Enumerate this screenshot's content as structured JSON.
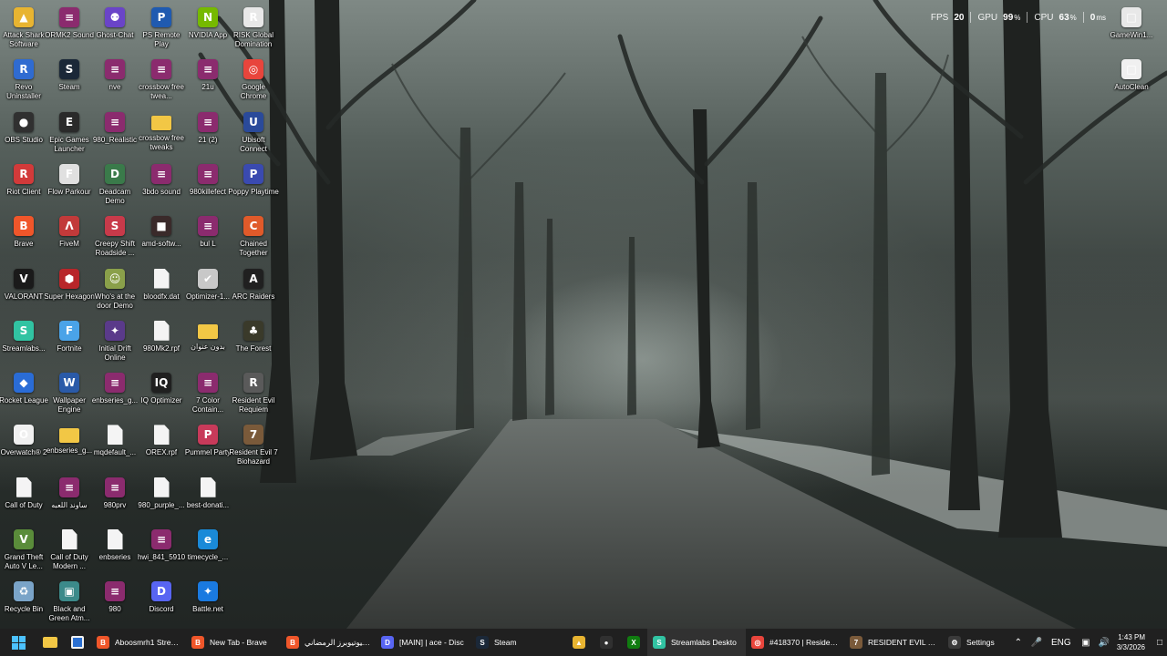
{
  "performance": {
    "fps_label": "FPS",
    "fps_value": "20",
    "gpu_label": "GPU",
    "gpu_value": "99",
    "gpu_unit": "%",
    "cpu_label": "CPU",
    "cpu_value": "63",
    "cpu_unit": "%",
    "extra_value": "0",
    "extra_unit": "ms"
  },
  "desktop_icons": [
    {
      "label": "Attack Shark Software",
      "icon": "shark-icon",
      "color": "#e8b431",
      "glyph": "▲",
      "col": 0,
      "row": 0
    },
    {
      "label": "Revo Uninstaller",
      "icon": "revo-icon",
      "color": "#2f6bd1",
      "glyph": "R",
      "col": 0,
      "row": 1
    },
    {
      "label": "OBS Studio",
      "icon": "obs-icon",
      "color": "#303030",
      "glyph": "●",
      "col": 0,
      "row": 2
    },
    {
      "label": "Riot Client",
      "icon": "riot-icon",
      "color": "#d23a3a",
      "glyph": "R",
      "col": 0,
      "row": 3
    },
    {
      "label": "Brave",
      "icon": "brave-icon",
      "color": "#f0562a",
      "glyph": "B",
      "col": 0,
      "row": 4
    },
    {
      "label": "VALORANT",
      "icon": "valorant-icon",
      "color": "#1a1a1a",
      "glyph": "V",
      "col": 0,
      "row": 5
    },
    {
      "label": "Streamlabs...",
      "icon": "streamlabs-icon",
      "color": "#31c3a2",
      "glyph": "S",
      "col": 0,
      "row": 6
    },
    {
      "label": "Rocket League",
      "icon": "rocket-league-icon",
      "color": "#2a6cd6",
      "glyph": "◆",
      "col": 0,
      "row": 7
    },
    {
      "label": "Overwatch® 2",
      "icon": "overwatch-icon",
      "color": "#f0f0f0",
      "glyph": "O",
      "col": 0,
      "row": 8
    },
    {
      "label": "Call of Duty",
      "icon": "doc-icon",
      "color": "",
      "glyph": "",
      "col": 0,
      "row": 9,
      "kind": "doc"
    },
    {
      "label": "Grand Theft Auto V Le...",
      "icon": "gta-icon",
      "color": "#5a8c3a",
      "glyph": "V",
      "col": 0,
      "row": 10
    },
    {
      "label": "Recycle Bin",
      "icon": "recycle-bin-icon",
      "color": "#7aa4c8",
      "glyph": "♻",
      "col": 0,
      "row": 11
    },
    {
      "label": "ORMK2 Sound",
      "icon": "winrar-icon",
      "color": "#8b2b6e",
      "glyph": "≡",
      "col": 1,
      "row": 0
    },
    {
      "label": "Steam",
      "icon": "steam-icon",
      "color": "#1b2838",
      "glyph": "S",
      "col": 1,
      "row": 1
    },
    {
      "label": "Epic Games Launcher",
      "icon": "epic-icon",
      "color": "#2a2a2a",
      "glyph": "E",
      "col": 1,
      "row": 2
    },
    {
      "label": "Flow Parkour",
      "icon": "flow-parkour-icon",
      "color": "#e0e0e0",
      "glyph": "F",
      "col": 1,
      "row": 3
    },
    {
      "label": "FiveM",
      "icon": "fivem-icon",
      "color": "#c23a3a",
      "glyph": "Λ",
      "col": 1,
      "row": 4
    },
    {
      "label": "Super Hexagon",
      "icon": "super-hexagon-icon",
      "color": "#b8262a",
      "glyph": "⬢",
      "col": 1,
      "row": 5
    },
    {
      "label": "Fortnite",
      "icon": "fortnite-icon",
      "color": "#4aa3e8",
      "glyph": "F",
      "col": 1,
      "row": 6
    },
    {
      "label": "Wallpaper Engine",
      "icon": "wallpaper-engine-icon",
      "color": "#2a5aa8",
      "glyph": "W",
      "col": 1,
      "row": 7
    },
    {
      "label": "enbseries_g...",
      "icon": "folder-icon",
      "color": "",
      "glyph": "",
      "col": 1,
      "row": 8,
      "kind": "folder"
    },
    {
      "label": "ساوند اللعبه",
      "icon": "winrar-icon",
      "color": "#8b2b6e",
      "glyph": "≡",
      "col": 1,
      "row": 9
    },
    {
      "label": "Call of Duty Modern ...",
      "icon": "doc-icon",
      "color": "",
      "glyph": "",
      "col": 1,
      "row": 10,
      "kind": "doc"
    },
    {
      "label": "Black and Green Atm...",
      "icon": "black-green-icon",
      "color": "#3c8a8a",
      "glyph": "▣",
      "col": 1,
      "row": 11
    },
    {
      "label": "Ghost-Chat",
      "icon": "ghost-chat-icon",
      "color": "#6a44c8",
      "glyph": "⚉",
      "col": 2,
      "row": 0
    },
    {
      "label": "nve",
      "icon": "winrar-icon",
      "color": "#8b2b6e",
      "glyph": "≡",
      "col": 2,
      "row": 1
    },
    {
      "label": "980_Realistic",
      "icon": "winrar-icon",
      "color": "#8b2b6e",
      "glyph": "≡",
      "col": 2,
      "row": 2
    },
    {
      "label": "Deadcam Demo",
      "icon": "deadcam-icon",
      "color": "#3a7a4a",
      "glyph": "D",
      "col": 2,
      "row": 3
    },
    {
      "label": "Creepy Shift Roadside ...",
      "icon": "creepy-shift-icon",
      "color": "#c83a4a",
      "glyph": "S",
      "col": 2,
      "row": 4
    },
    {
      "label": "Who's at the door Demo",
      "icon": "whos-at-door-icon",
      "color": "#8aa04a",
      "glyph": "☺",
      "col": 2,
      "row": 5
    },
    {
      "label": "Initial Drift Online",
      "icon": "initial-drift-icon",
      "color": "#5a3a8a",
      "glyph": "✦",
      "col": 2,
      "row": 6
    },
    {
      "label": "enbseries_g...",
      "icon": "winrar-icon",
      "color": "#8b2b6e",
      "glyph": "≡",
      "col": 2,
      "row": 7
    },
    {
      "label": "mqdefault_...",
      "icon": "doc-icon",
      "color": "",
      "glyph": "",
      "col": 2,
      "row": 8,
      "kind": "doc"
    },
    {
      "label": "980prv",
      "icon": "winrar-icon",
      "color": "#8b2b6e",
      "glyph": "≡",
      "col": 2,
      "row": 9
    },
    {
      "label": "enbseries",
      "icon": "doc-icon",
      "color": "",
      "glyph": "",
      "col": 2,
      "row": 10,
      "kind": "doc"
    },
    {
      "label": "980",
      "icon": "winrar-icon",
      "color": "#8b2b6e",
      "glyph": "≡",
      "col": 2,
      "row": 11
    },
    {
      "label": "PS Remote Play",
      "icon": "ps-remote-icon",
      "color": "#1f5ab0",
      "glyph": "P",
      "col": 3,
      "row": 0
    },
    {
      "label": "crossbow free twea...",
      "icon": "winrar-icon",
      "color": "#8b2b6e",
      "glyph": "≡",
      "col": 3,
      "row": 1
    },
    {
      "label": "crossbow free tweaks",
      "icon": "folder-icon",
      "color": "",
      "glyph": "",
      "col": 3,
      "row": 2,
      "kind": "folder"
    },
    {
      "label": "3bdo sound",
      "icon": "winrar-icon",
      "color": "#8b2b6e",
      "glyph": "≡",
      "col": 3,
      "row": 3
    },
    {
      "label": "amd-softw...",
      "icon": "amd-icon",
      "color": "#3a2a2a",
      "glyph": "■",
      "col": 3,
      "row": 4
    },
    {
      "label": "bloodfx.dat",
      "icon": "doc-icon",
      "color": "",
      "glyph": "",
      "col": 3,
      "row": 5,
      "kind": "doc"
    },
    {
      "label": "980Mk2.rpf",
      "icon": "doc-icon",
      "color": "",
      "glyph": "",
      "col": 3,
      "row": 6,
      "kind": "doc"
    },
    {
      "label": "IQ Optimizer",
      "icon": "iq-optimizer-icon",
      "color": "#202020",
      "glyph": "IQ",
      "col": 3,
      "row": 7
    },
    {
      "label": "OREX.rpf",
      "icon": "doc-icon",
      "color": "",
      "glyph": "",
      "col": 3,
      "row": 8,
      "kind": "doc"
    },
    {
      "label": "980_purple_...",
      "icon": "doc-icon",
      "color": "",
      "glyph": "",
      "col": 3,
      "row": 9,
      "kind": "doc"
    },
    {
      "label": "hwi_841_5910",
      "icon": "winrar-icon",
      "color": "#8b2b6e",
      "glyph": "≡",
      "col": 3,
      "row": 10
    },
    {
      "label": "Discord",
      "icon": "discord-icon",
      "color": "#5865f2",
      "glyph": "D",
      "col": 3,
      "row": 11
    },
    {
      "label": "NVIDIA App",
      "icon": "nvidia-icon",
      "color": "#76b900",
      "glyph": "N",
      "col": 4,
      "row": 0
    },
    {
      "label": "21u",
      "icon": "winrar-icon",
      "color": "#8b2b6e",
      "glyph": "≡",
      "col": 4,
      "row": 1
    },
    {
      "label": "21 (2)",
      "icon": "winrar-icon",
      "color": "#8b2b6e",
      "glyph": "≡",
      "col": 4,
      "row": 2
    },
    {
      "label": "980killefect",
      "icon": "winrar-icon",
      "color": "#8b2b6e",
      "glyph": "≡",
      "col": 4,
      "row": 3
    },
    {
      "label": "bul L",
      "icon": "winrar-icon",
      "color": "#8b2b6e",
      "glyph": "≡",
      "col": 4,
      "row": 4
    },
    {
      "label": "Optimizer-1...",
      "icon": "optimizer-icon",
      "color": "#c8c8c8",
      "glyph": "✔",
      "col": 4,
      "row": 5
    },
    {
      "label": "بدون عنوان",
      "icon": "folder-icon",
      "color": "",
      "glyph": "",
      "col": 4,
      "row": 6,
      "kind": "folder"
    },
    {
      "label": "7 Color Contain...",
      "icon": "winrar-icon",
      "color": "#8b2b6e",
      "glyph": "≡",
      "col": 4,
      "row": 7
    },
    {
      "label": "Pummel Party",
      "icon": "pummel-party-icon",
      "color": "#c83a5a",
      "glyph": "P",
      "col": 4,
      "row": 8
    },
    {
      "label": "best-donati...",
      "icon": "doc-icon",
      "color": "",
      "glyph": "",
      "col": 4,
      "row": 9,
      "kind": "doc"
    },
    {
      "label": "timecycle_...",
      "icon": "edge-icon",
      "color": "#1a8ad8",
      "glyph": "e",
      "col": 4,
      "row": 10
    },
    {
      "label": "Battle.net",
      "icon": "battlenet-icon",
      "color": "#1a7ae0",
      "glyph": "✦",
      "col": 4,
      "row": 11
    },
    {
      "label": "RISK Global Domination",
      "icon": "risk-icon",
      "color": "#e8e8e8",
      "glyph": "R",
      "col": 5,
      "row": 0
    },
    {
      "label": "Google Chrome",
      "icon": "chrome-icon",
      "color": "#e8453c",
      "glyph": "◎",
      "col": 5,
      "row": 1
    },
    {
      "label": "Ubisoft Connect",
      "icon": "ubisoft-icon",
      "color": "#2a4a9a",
      "glyph": "U",
      "col": 5,
      "row": 2
    },
    {
      "label": "Poppy Playtime",
      "icon": "poppy-icon",
      "color": "#3a4ab0",
      "glyph": "P",
      "col": 5,
      "row": 3
    },
    {
      "label": "Chained Together",
      "icon": "chained-icon",
      "color": "#e05a2a",
      "glyph": "C",
      "col": 5,
      "row": 4
    },
    {
      "label": "ARC Raiders",
      "icon": "arc-raiders-icon",
      "color": "#202020",
      "glyph": "A",
      "col": 5,
      "row": 5
    },
    {
      "label": "The Forest",
      "icon": "the-forest-icon",
      "color": "#3a3a2a",
      "glyph": "♣",
      "col": 5,
      "row": 6
    },
    {
      "label": "Resident Evil Requiem",
      "icon": "re-requiem-icon",
      "color": "#5a5a5a",
      "glyph": "R",
      "col": 5,
      "row": 7
    },
    {
      "label": "Resident Evil 7 Biohazard",
      "icon": "re7-icon",
      "color": "#7a5a3a",
      "glyph": "7",
      "col": 5,
      "row": 8
    }
  ],
  "right_icons": [
    {
      "label": "GameWin1...",
      "icon": "gamewin-icon",
      "col": "r",
      "row": 0
    },
    {
      "label": "AutoClean",
      "icon": "autoclean-icon",
      "col": "r",
      "row": 1
    }
  ],
  "taskbar": {
    "apps": [
      {
        "label": "Aboosmrh1 Stream - V",
        "icon": "brave-icon",
        "color": "#f0562a",
        "glyph": "B"
      },
      {
        "label": "New Tab - Brave",
        "icon": "brave-icon",
        "color": "#f0562a",
        "glyph": "B"
      },
      {
        "label": "تحدي اليوتيوبرز الرمضاني",
        "icon": "brave-icon",
        "color": "#f0562a",
        "glyph": "B"
      },
      {
        "label": "[MAIN] | ace - Disc",
        "icon": "discord-icon",
        "color": "#5865f2",
        "glyph": "D"
      },
      {
        "label": "Steam",
        "icon": "steam-icon",
        "color": "#1b2838",
        "glyph": "S"
      }
    ],
    "pinned": [
      {
        "icon": "shark-taskbar-icon",
        "color": "#e8b431",
        "glyph": "▲"
      },
      {
        "icon": "obs-taskbar-icon",
        "color": "#303030",
        "glyph": "●"
      },
      {
        "icon": "xbox-icon",
        "color": "#107c10",
        "glyph": "X"
      }
    ],
    "apps2": [
      {
        "label": "Streamlabs Deskto",
        "icon": "streamlabs-icon",
        "color": "#31c3a2",
        "glyph": "S",
        "active": true
      },
      {
        "label": "#418370 | Resident Evi",
        "icon": "chrome-icon",
        "color": "#e8453c",
        "glyph": "◎"
      },
      {
        "label": "RESIDENT EVIL 7 bioh",
        "icon": "re7-icon",
        "color": "#7a5a3a",
        "glyph": "7"
      },
      {
        "label": "Settings",
        "icon": "settings-icon",
        "color": "#3a3a3a",
        "glyph": "⚙"
      }
    ],
    "language": "ENG",
    "time": "1:43 PM",
    "date": "3/3/2026"
  }
}
